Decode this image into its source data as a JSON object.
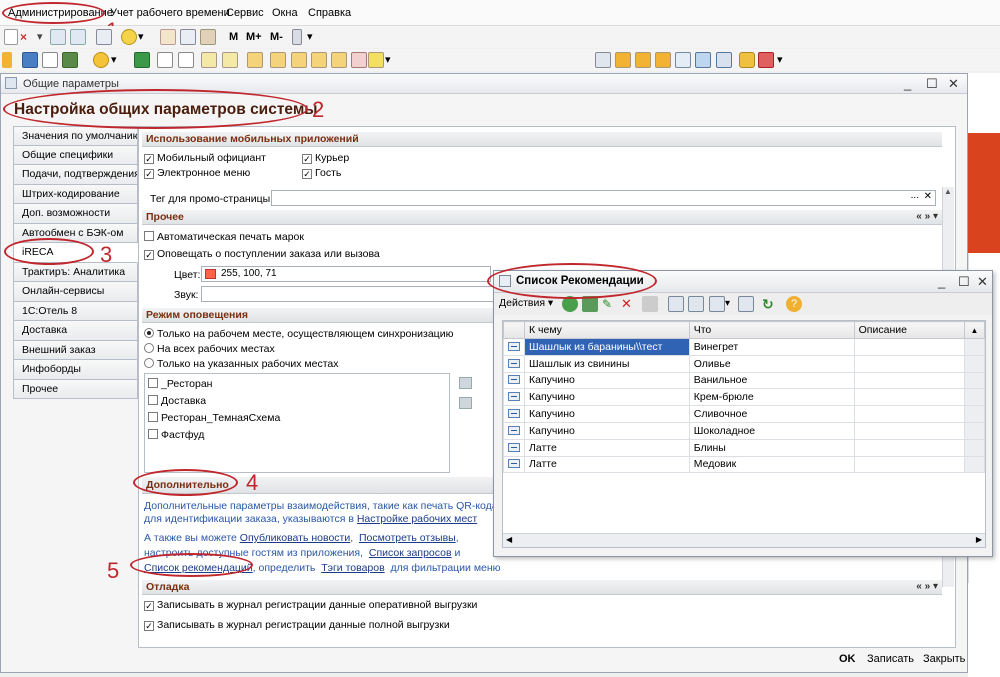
{
  "menubar": {
    "items": [
      "Администрирование",
      "Учет рабочего времени",
      "Сервис",
      "Окна",
      "Справка"
    ]
  },
  "toolbar": {
    "m_label": "M",
    "mplus_label": "M+",
    "mminus_label": "M-"
  },
  "annotations": {
    "n1": "1",
    "n2": "2",
    "n3": "3",
    "n4": "4",
    "n5": "5"
  },
  "main_window": {
    "title": "Общие параметры",
    "heading": "Настройка общих параметров системы",
    "tabs": [
      "Значения по умолчанию",
      "Общие специфики",
      "Подачи, подтверждения",
      "Штрих-кодирование",
      "Доп. возможности",
      "Автообмен с БЭК-ом",
      "iRECA",
      "Трактиръ: Аналитика",
      "Онлайн-сервисы",
      "1С:Отель 8",
      "Доставка",
      "Внешний заказ",
      "Инфоборды",
      "Прочее"
    ],
    "mobile": {
      "header": "Использование мобильных приложений",
      "waiter": "Мобильный официант",
      "courier": "Курьер",
      "emenu": "Электронное меню",
      "guest": "Гость",
      "promo_label": "Тег для промо-страницы:",
      "promo_value": ""
    },
    "other": {
      "header": "Прочее",
      "auto_print": "Автоматическая печать марок",
      "notify": "Оповещать о поступлении заказа или вызова",
      "color_label": "Цвет:",
      "color_value": "255, 100, 71",
      "color_hex": "#ff6447",
      "sound_label": "Звук:",
      "sound_value": ""
    },
    "notify_mode": {
      "header": "Режим оповещения",
      "opt1": "Только на рабочем месте, осуществляющем синхронизацию",
      "opt2": "На всех рабочих местах",
      "opt3": "Только на указанных рабочих местах",
      "places": [
        "_Ресторан",
        "Доставка",
        "Ресторан_ТемнаяСхема",
        "Фастфуд"
      ]
    },
    "additional": {
      "header": "Дополнительно",
      "desc1": "Дополнительные параметры взаимодействия, такие как печать QR-кода",
      "desc2": "для идентификации заказа, указываются в ",
      "link_workplaces": "Настройке рабочих мест",
      "desc3": "А также вы можете ",
      "link_publish": "Опубликовать новости",
      "link_reviews": "Посмотреть отзывы",
      "desc4": "настроить доступные гостям из приложения,",
      "link_requests": "Список запросов",
      "desc4b": "и",
      "link_recommendations": "Список рекомендаций",
      "desc5": ", определить",
      "link_tags": "Тэги товаров",
      "desc6": "для фильтрации меню"
    },
    "debug": {
      "header": "Отладка",
      "log_operative": "Записывать в журнал регистрации данные оперативной выгрузки",
      "log_full": "Записывать в журнал регистрации данные полной выгрузки"
    },
    "footer": {
      "ok": "OK",
      "save": "Записать",
      "close": "Закрыть"
    }
  },
  "popup": {
    "title": "Список Рекомендации",
    "actions_label": "Действия",
    "columns": [
      "К чему",
      "Что",
      "Описание"
    ],
    "rows": [
      {
        "to": "Шашлык из баранины\\\\тест",
        "what": "Винегрет",
        "desc": ""
      },
      {
        "to": "Шашлык из свинины",
        "what": "Оливье",
        "desc": ""
      },
      {
        "to": "Капучино",
        "what": "Ванильное",
        "desc": ""
      },
      {
        "to": "Капучино",
        "what": "Крем-брюле",
        "desc": ""
      },
      {
        "to": "Капучино",
        "what": "Сливочное",
        "desc": ""
      },
      {
        "to": "Капучино",
        "what": "Шоколадное",
        "desc": ""
      },
      {
        "to": "Латте",
        "what": "Блины",
        "desc": ""
      },
      {
        "to": "Латте",
        "what": "Медовик",
        "desc": ""
      }
    ]
  },
  "colors": {
    "annotation": "#c0272d",
    "accent_right": "#d9431e",
    "selection": "#3163b5"
  }
}
